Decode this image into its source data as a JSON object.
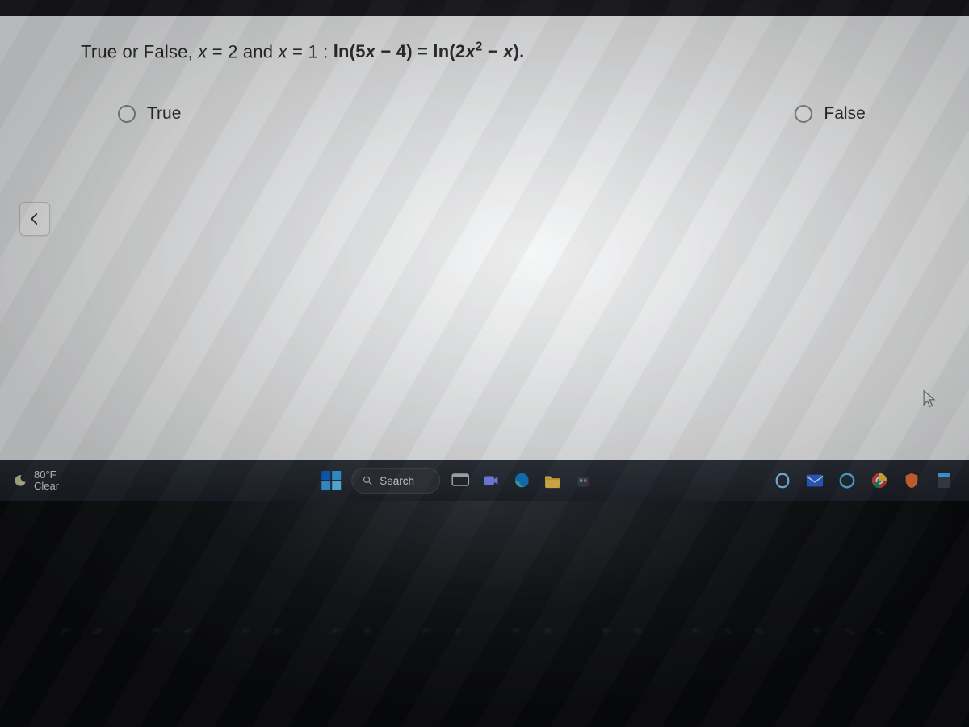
{
  "question": {
    "prefix": "True or False, ",
    "cond_a_var": "x",
    "cond_a_eq": " = 2 and ",
    "cond_b_var": "x",
    "cond_b_eq": " = 1 :  ",
    "lhs_fn": "ln(5",
    "lhs_var": "x",
    "lhs_tail": " − 4) = ln(2",
    "rhs_var": "x",
    "rhs_exp": "2",
    "rhs_tail": " − ",
    "rhs_last_var": "x",
    "rhs_close": ")."
  },
  "options": {
    "true_label": "True",
    "false_label": "False"
  },
  "taskbar": {
    "weather_temp": "80°F",
    "weather_cond": "Clear",
    "search_placeholder": "Search"
  },
  "keyboard": {
    "fnrow": "F3   F4   F5   F6   F7   F8   F9   F10   F11"
  }
}
